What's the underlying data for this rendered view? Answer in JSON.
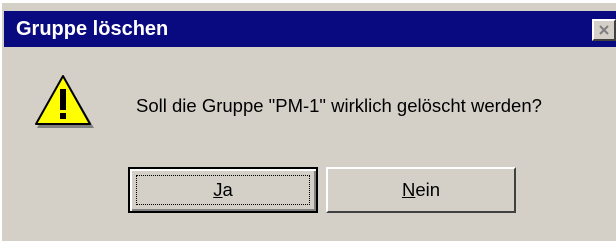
{
  "window": {
    "title": "Gruppe löschen",
    "close_icon": "close-icon",
    "titlebar_color": "#0a0a80"
  },
  "content": {
    "icon": "warning-icon",
    "message": "Soll die Gruppe \"PM-1\" wirklich gelöscht werden?"
  },
  "buttons": {
    "yes": {
      "mnemonic": "J",
      "rest": "a"
    },
    "no": {
      "mnemonic": "N",
      "rest": "ein"
    }
  }
}
